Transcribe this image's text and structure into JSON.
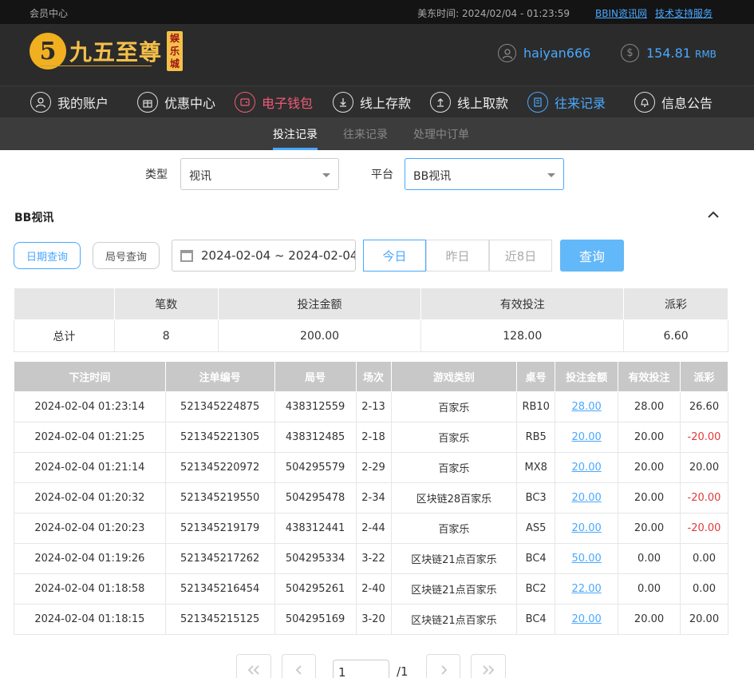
{
  "topbar": {
    "member_center": "会员中心",
    "time_label": "美东时间: 2024/02/04 - 01:23:59",
    "link_bbin": "BBIN资讯网",
    "link_support": "技术支持服务"
  },
  "header": {
    "logo_mark": "5",
    "logo_text": "九五至尊",
    "logo_tag": "娱乐城",
    "username": "haiyan666",
    "balance": "154.81",
    "currency": "RMB"
  },
  "nav": {
    "items": [
      {
        "label": "我的账户",
        "icon": "user-icon"
      },
      {
        "label": "优惠中心",
        "icon": "gift-icon"
      },
      {
        "label": "电子钱包",
        "icon": "wallet-icon"
      },
      {
        "label": "线上存款",
        "icon": "deposit-icon"
      },
      {
        "label": "线上取款",
        "icon": "withdraw-icon"
      },
      {
        "label": "往来记录",
        "icon": "records-icon"
      },
      {
        "label": "信息公告",
        "icon": "bell-icon"
      }
    ]
  },
  "subtabs": [
    "投注记录",
    "往来记录",
    "处理中订单"
  ],
  "filters": {
    "type_label": "类型",
    "type_value": "视讯",
    "platform_label": "平台",
    "platform_value": "BB视讯"
  },
  "section_title": "BB视讯",
  "query": {
    "date_query": "日期查询",
    "round_query": "局号查询",
    "date_range": "2024-02-04 ~ 2024-02-04",
    "today": "今日",
    "yesterday": "昨日",
    "last8": "近8日",
    "submit": "查询"
  },
  "summary": {
    "headers": [
      "",
      "笔数",
      "投注金额",
      "有效投注",
      "派彩"
    ],
    "row": [
      "总计",
      "8",
      "200.00",
      "128.00",
      "6.60"
    ]
  },
  "detail": {
    "headers": [
      "下注时间",
      "注单编号",
      "局号",
      "场次",
      "游戏类别",
      "桌号",
      "投注金额",
      "有效投注",
      "派彩"
    ],
    "rows": [
      [
        "2024-02-04 01:23:14",
        "521345224875",
        "438312559",
        "2-13",
        "百家乐",
        "RB10",
        "28.00",
        "28.00",
        "26.60"
      ],
      [
        "2024-02-04 01:21:25",
        "521345221305",
        "438312485",
        "2-18",
        "百家乐",
        "RB5",
        "20.00",
        "20.00",
        "-20.00"
      ],
      [
        "2024-02-04 01:21:14",
        "521345220972",
        "504295579",
        "2-29",
        "百家乐",
        "MX8",
        "20.00",
        "20.00",
        "20.00"
      ],
      [
        "2024-02-04 01:20:32",
        "521345219550",
        "504295478",
        "2-34",
        "区块链28百家乐",
        "BC3",
        "20.00",
        "20.00",
        "-20.00"
      ],
      [
        "2024-02-04 01:20:23",
        "521345219179",
        "438312441",
        "2-44",
        "百家乐",
        "AS5",
        "20.00",
        "20.00",
        "-20.00"
      ],
      [
        "2024-02-04 01:19:26",
        "521345217262",
        "504295334",
        "3-22",
        "区块链21点百家乐",
        "BC4",
        "50.00",
        "0.00",
        "0.00"
      ],
      [
        "2024-02-04 01:18:58",
        "521345216454",
        "504295261",
        "2-40",
        "区块链21点百家乐",
        "BC2",
        "22.00",
        "0.00",
        "0.00"
      ],
      [
        "2024-02-04 01:18:15",
        "521345215125",
        "504295169",
        "3-20",
        "区块链21点百家乐",
        "BC4",
        "20.00",
        "20.00",
        "20.00"
      ]
    ]
  },
  "pagination": {
    "current_page": "1",
    "total": "/1"
  },
  "colors": {
    "accent": "#4aa8ff",
    "negative": "#e03a3a",
    "wallet_pink": "#f05a78",
    "logo_gold": "#f4c04a"
  }
}
